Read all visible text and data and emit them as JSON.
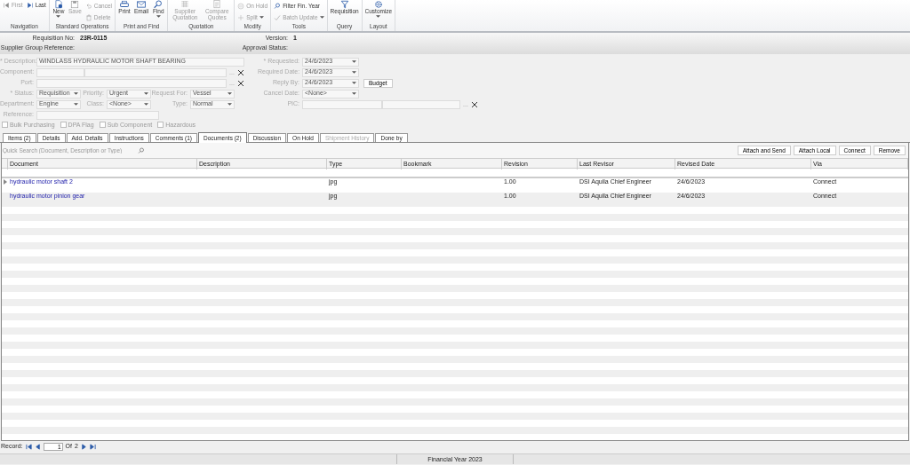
{
  "ribbon": {
    "groups": [
      {
        "label": "Navigation",
        "buttons": [
          {
            "label": "First",
            "disabled": true,
            "dropdown": false
          },
          {
            "label": "Last",
            "disabled": false,
            "dropdown": false
          }
        ]
      },
      {
        "label": "Standard Operations",
        "buttons": [
          {
            "label": "New",
            "disabled": false,
            "dropdown": true
          },
          {
            "label": "Save",
            "disabled": true,
            "dropdown": false
          },
          {
            "label": "Cancel",
            "disabled": true,
            "dropdown": false
          },
          {
            "label": "Delete",
            "disabled": true,
            "dropdown": false
          }
        ]
      },
      {
        "label": "Print and Find",
        "buttons": [
          {
            "label": "Print",
            "disabled": false,
            "dropdown": false
          },
          {
            "label": "Email",
            "disabled": false,
            "dropdown": false
          },
          {
            "label": "Find",
            "disabled": false,
            "dropdown": true
          }
        ]
      },
      {
        "label": "Quotation",
        "buttons": [
          {
            "label": "Supplier Quotation",
            "disabled": true,
            "dropdown": false
          },
          {
            "label": "Compare Quotes",
            "disabled": true,
            "dropdown": false
          }
        ]
      },
      {
        "label": "Modify",
        "buttons": [
          {
            "label": "On Hold",
            "disabled": true,
            "dropdown": false
          },
          {
            "label": "Split",
            "disabled": true,
            "dropdown": true
          }
        ]
      },
      {
        "label": "Tools",
        "buttons": [
          {
            "label": "Filter Fin. Year",
            "disabled": false,
            "dropdown": false
          },
          {
            "label": "Batch Update",
            "disabled": true,
            "dropdown": true
          }
        ]
      },
      {
        "label": "Query",
        "buttons": [
          {
            "label": "Requisition",
            "disabled": false,
            "dropdown": false
          }
        ]
      },
      {
        "label": "Layout",
        "buttons": [
          {
            "label": "Customize",
            "disabled": false,
            "dropdown": true
          }
        ]
      }
    ]
  },
  "header": [
    {
      "label": "Requisition No:",
      "value": "23R-0115"
    },
    {
      "label": "Version:",
      "value": "1"
    },
    {
      "label": "Supplier Group Reference:"
    },
    {
      "label": "Approval Status:"
    }
  ],
  "form": {
    "disabled": true,
    "left": [
      {
        "kind": "text",
        "label": "* Description:",
        "value": "WINDLASS HYDRAULIC MOTOR SHAFT BEARING"
      },
      {
        "kind": "lookup2",
        "label": "Component:",
        "lookup_button": "..."
      },
      {
        "kind": "lookup",
        "label": "Port:",
        "lookup_button": "..."
      },
      {
        "kind": "selects",
        "items": [
          {
            "label": "* Status:",
            "value": "Requisition"
          },
          {
            "label": "Priority:",
            "value": "Urgent"
          },
          {
            "label": "Request For:",
            "value": "Vessel"
          }
        ]
      },
      {
        "kind": "selects",
        "items": [
          {
            "label": "Department:",
            "value": "Engine"
          },
          {
            "label": "Class:",
            "value": "<None>"
          },
          {
            "label": "Type:",
            "value": "Normal"
          }
        ]
      },
      {
        "kind": "short",
        "label": "Reference:"
      }
    ],
    "right": [
      {
        "kind": "date",
        "label": "* Requested:",
        "value": "24/6/2023"
      },
      {
        "kind": "date",
        "label": "Required Date:",
        "value": "24/6/2023"
      },
      {
        "kind": "date",
        "label": "Reply By:",
        "value": "24/6/2023",
        "button": "Budget"
      },
      {
        "kind": "date",
        "label": "Cancel Date:",
        "value": "<None>"
      },
      {
        "kind": "lookup",
        "label": "PIC:",
        "lookup_button": "..."
      }
    ],
    "checkboxes": [
      {
        "label": "Bulk Purchasing",
        "checked": false
      },
      {
        "label": "DPA Flag",
        "checked": false
      },
      {
        "label": "Sub Component",
        "checked": false
      },
      {
        "label": "Hazardous",
        "checked": false
      }
    ]
  },
  "tabs": [
    {
      "label": "Items (2)",
      "selected": false,
      "disabled": false
    },
    {
      "label": "Details",
      "selected": false,
      "disabled": false
    },
    {
      "label": "Add. Details",
      "selected": false,
      "disabled": false
    },
    {
      "label": "Instructions",
      "selected": false,
      "disabled": false
    },
    {
      "label": "Comments (1)",
      "selected": false,
      "disabled": false
    },
    {
      "label": "Documents (2)",
      "selected": true,
      "disabled": false
    },
    {
      "label": "Discussion",
      "selected": false,
      "disabled": false
    },
    {
      "label": "On Hold",
      "selected": false,
      "disabled": false
    },
    {
      "label": "Shipment History",
      "selected": false,
      "disabled": true
    },
    {
      "label": "Done by",
      "selected": false,
      "disabled": false
    }
  ],
  "search": {
    "placeholder": "Quick Search (Document, Description or Type)"
  },
  "actions": [
    "Attach and Send",
    "Attach Local",
    "Connect",
    "Remove"
  ],
  "table": {
    "columns": [
      "Document",
      "Description",
      "Type",
      "Bookmark",
      "Revision",
      "Last Revisor",
      "Revised Date",
      "Via"
    ],
    "rows": [
      {
        "selected": true,
        "cells": [
          "hydraulic motor shaft 2",
          "",
          "jpg",
          "",
          "1.00",
          "DSI Aquila Chief Engineer",
          "24/6/2023",
          "Connect"
        ]
      },
      {
        "selected": false,
        "cells": [
          "hydraulic motor pinion gear",
          "",
          "jpg",
          "",
          "1.00",
          "DSI Aquila Chief Engineer",
          "24/6/2023",
          "Connect"
        ]
      }
    ]
  },
  "record_nav": {
    "label": "Record:",
    "current": "1",
    "of": "Of",
    "total": "2"
  },
  "status_bar": {
    "text": "Financial Year 2023"
  }
}
